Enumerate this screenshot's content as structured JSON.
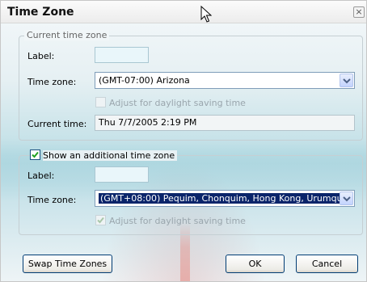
{
  "window": {
    "title": "Time Zone",
    "close_glyph": "×"
  },
  "current_group": {
    "legend": "Current time zone",
    "label_caption": "Label:",
    "label_value": "",
    "timezone_caption": "Time zone:",
    "timezone_value": "(GMT-07:00) Arizona",
    "dst_label": "Adjust for daylight saving time",
    "dst_checked": false,
    "dst_enabled": false,
    "current_time_caption": "Current time:",
    "current_time_value": "Thu 7/7/2005 2:19 PM"
  },
  "additional_group": {
    "show_label": "Show an additional time zone",
    "show_checked": true,
    "label_caption": "Label:",
    "label_value": "",
    "timezone_caption": "Time zone:",
    "timezone_value": "(GMT+08:00) Pequim, Chonquim, Hong Kong, Urumqu",
    "dst_label": "Adjust for daylight saving time",
    "dst_checked": true,
    "dst_enabled": false
  },
  "buttons": {
    "swap": "Swap Time Zones",
    "ok": "OK",
    "cancel": "Cancel"
  },
  "icons": [
    "close-icon",
    "mouse-cursor-icon",
    "chevron-down-icon",
    "checkmark-icon"
  ]
}
